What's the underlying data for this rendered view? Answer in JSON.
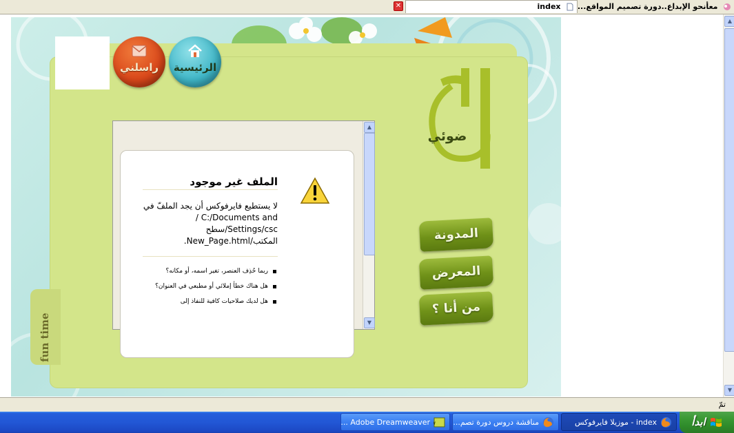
{
  "browser": {
    "tabs": [
      {
        "label": "معأنحو الإبداع..دورة تصميم المواقع...",
        "icon": "favicon-icon",
        "active": false
      },
      {
        "label": "index",
        "icon": "page-icon",
        "active": true
      }
    ],
    "status_text": "تمّ"
  },
  "site": {
    "nav": {
      "home_label": "الرئيسية",
      "contact_label": "راسلني"
    },
    "logo_text": "ضوئي",
    "side_buttons": [
      {
        "label": "المدونة"
      },
      {
        "label": "المعرض"
      },
      {
        "label": "من أنا ؟"
      }
    ],
    "side_tab": "fun time",
    "error_page": {
      "title": "الملف غير موجود",
      "message_lines": [
        "لا يستطيع فايرفوكس أن يجد الملفّ في",
        "C:/Documents and /",
        "Settings/csc/سطح",
        "المكتب/New_Page.html."
      ],
      "suggestions": [
        "ربما حُذِف العنصر، تغير اسمه، أو مكانه؟",
        "هل هناك خطأ إملائي أو مطبعي في العنوان؟",
        "هل لديك صلاحيات كافية للنفاذ إلى"
      ]
    }
  },
  "taskbar": {
    "start_label": "ابدأ",
    "buttons": [
      {
        "label": "index - موزيلا فايرفوكس",
        "active": true
      },
      {
        "label": "مناقشة دروس دورة تصم...",
        "active": false
      },
      {
        "label": "Adobe Dreamweaver ...",
        "active": false
      }
    ]
  },
  "colors": {
    "panel": "#d3e58a",
    "side_button": "#6f9118",
    "taskbar": "#2257d5",
    "start_button": "#3b9a35"
  }
}
